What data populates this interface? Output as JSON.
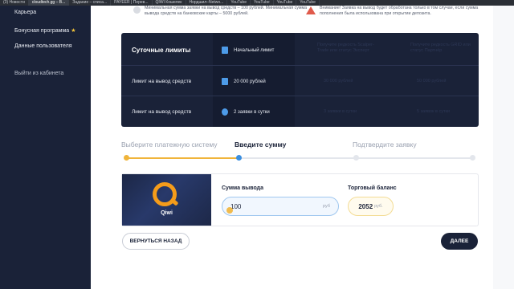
{
  "browser": {
    "tabs": [
      {
        "label": "(3) Новости",
        "active": false
      },
      {
        "label": "cloudtech.gg – В...",
        "active": true
      },
      {
        "label": "Задание – списа...",
        "active": false
      },
      {
        "label": "PAYEER | Перев...",
        "active": false
      },
      {
        "label": "QIWI Кошелек",
        "active": false
      },
      {
        "label": "Нордшил–Netwo...",
        "active": false
      },
      {
        "label": "YouTube",
        "active": false
      },
      {
        "label": "YouTube",
        "active": false
      },
      {
        "label": "YouTube",
        "active": false
      },
      {
        "label": "YouTube",
        "active": false
      }
    ]
  },
  "sidebar": {
    "items": [
      {
        "label": "Карьера"
      },
      {
        "label": "Бонусная программа",
        "badge": "★"
      },
      {
        "label": "Данные пользователя"
      },
      {
        "label": "Выйти из кабинета"
      }
    ]
  },
  "notices": {
    "left": "Минимальная сумма заявки на вывод средств – 100 рублей. Минимальная сумма вывода средств на банковские карты – 5000 рублей.",
    "right": "Внимание! Заявка на вывод будет обработана только в том случае, если сумма пополнения была использована при открытии депозита."
  },
  "limits": {
    "title": "Суточные лимиты",
    "tier_label": "Начальный лимит",
    "ghost_tiers": [
      "Получите редкость Scalper-Trade или статус Эксперт",
      "Получите редкость GRID или статус Партнёр"
    ],
    "rows": [
      {
        "label": "Лимит на вывод средств",
        "value": "20 000 рублей",
        "ghost": [
          "30 000 рублей",
          "50 000 рублей"
        ]
      },
      {
        "label": "Лимит на вывод средств",
        "value": "2 заявки в сутки",
        "ghost": [
          "3 заявки в сутки",
          "5 заявок в сутки"
        ]
      }
    ]
  },
  "steps": [
    {
      "label": "Выберите платежную систему",
      "state": "done"
    },
    {
      "label": "Введите сумму",
      "state": "active"
    },
    {
      "label": "Подтвердите заявку",
      "state": "pending"
    }
  ],
  "payment": {
    "method": "Qiwi",
    "amount_label": "Сумма вывода",
    "amount_value": "100",
    "amount_currency": "руб",
    "balance_label": "Торговый баланс",
    "balance_value": "2052",
    "balance_currency": "руб."
  },
  "buttons": {
    "back": "ВЕРНУТЬСЯ НАЗАД",
    "next": "ДАЛЕЕ"
  },
  "colors": {
    "navy": "#1a2238",
    "accent_blue": "#3b8fe0",
    "accent_yellow": "#f0b43a",
    "qiwi_orange": "#f59c1a"
  }
}
